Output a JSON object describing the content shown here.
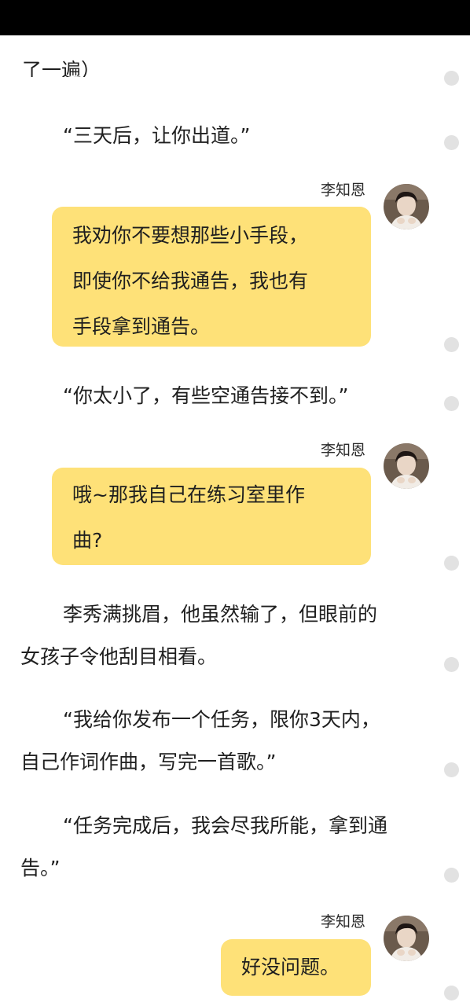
{
  "status_bar": {
    "color": "#000000"
  },
  "bubble_color": "#fee178",
  "content": {
    "cut_top_line": "了一遍）",
    "p1": "“三天后，让你出道。”",
    "chat1": {
      "speaker": "李知恩",
      "lines": [
        "我劝你不要想那些小手段，",
        "即使你不给我通告，我也有",
        "手段拿到通告。"
      ]
    },
    "p2": "“你太小了，有些空通告接不到。”",
    "chat2": {
      "speaker": "李知恩",
      "lines": [
        "哦~那我自己在练习室里作",
        "曲?"
      ]
    },
    "p3": [
      "李秀满挑眉，他虽然输了，但眼前的",
      "女孩子令他刮目相看。"
    ],
    "p4": [
      "“我给你发布一个任务，限你3天内，",
      "自己作词作曲，写完一首歌。”"
    ],
    "p5": [
      "“任务完成后，我会尽我所能，拿到通",
      "告。”"
    ],
    "chat3": {
      "speaker": "李知恩",
      "lines": [
        "好没问题。"
      ]
    }
  },
  "icons": {
    "avatar": "avatar-portrait-icon",
    "comment_dot": "comment-dot-icon"
  }
}
